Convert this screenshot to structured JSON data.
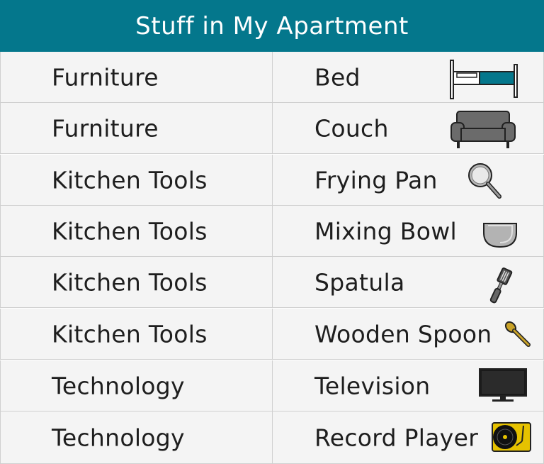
{
  "title": "Stuff in My Apartment",
  "colors": {
    "header_bg": "#04778c",
    "cell_bg": "#f4f4f4",
    "border": "#cfcfcf",
    "text": "#1e1e1e"
  },
  "rows": [
    {
      "category": "Furniture",
      "item": "Bed",
      "icon": "bed-icon"
    },
    {
      "category": "Furniture",
      "item": "Couch",
      "icon": "couch-icon"
    },
    {
      "category": "Kitchen Tools",
      "item": "Frying Pan",
      "icon": "frying-pan-icon"
    },
    {
      "category": "Kitchen Tools",
      "item": "Mixing Bowl",
      "icon": "mixing-bowl-icon"
    },
    {
      "category": "Kitchen Tools",
      "item": "Spatula",
      "icon": "spatula-icon"
    },
    {
      "category": "Kitchen Tools",
      "item": "Wooden Spoon",
      "icon": "wooden-spoon-icon"
    },
    {
      "category": "Technology",
      "item": "Television",
      "icon": "television-icon"
    },
    {
      "category": "Technology",
      "item": "Record Player",
      "icon": "record-player-icon"
    }
  ]
}
